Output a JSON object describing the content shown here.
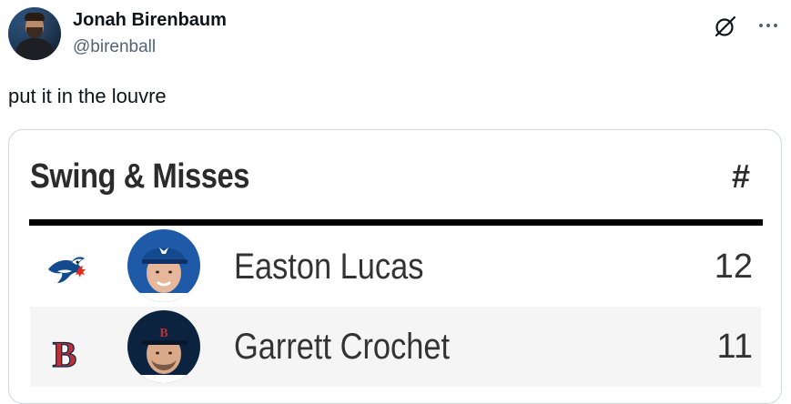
{
  "tweet": {
    "display_name": "Jonah Birenbaum",
    "handle": "@birenball",
    "text": "put it in the louvre"
  },
  "card": {
    "title": "Swing & Misses",
    "column_header": "#",
    "rows": [
      {
        "team_logo": "blue-jays-logo",
        "name": "Easton Lucas",
        "count": "12"
      },
      {
        "team_logo": "red-sox-logo",
        "name": "Garrett Crochet",
        "count": "11"
      }
    ]
  },
  "colors": {
    "handle_gray": "#536471",
    "border": "#cfd9de",
    "row_alt": "#f5f5f5",
    "blue_jays_blue": "#134a8e",
    "red_sox_red": "#bd3039"
  },
  "icons": {
    "grok": "grok-icon",
    "more": "more-options-icon"
  }
}
